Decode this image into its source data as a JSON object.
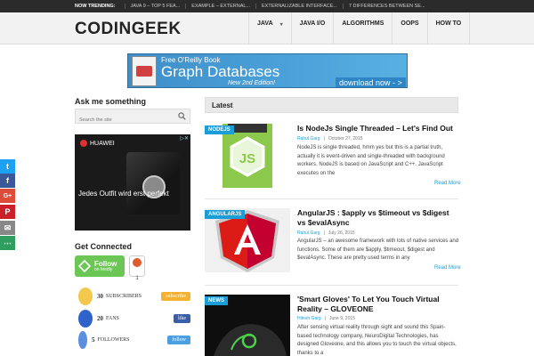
{
  "trending": {
    "label": "NOW TRENDING:",
    "items": [
      "JAVA 9 – TOP 5 FEA...",
      "EXAMPLE – EXTERNAL...",
      "EXTERNALIZABLE INTERFACE...",
      "7 DIFFERENCES BETWEEN SE..."
    ]
  },
  "header": {
    "logo": "CODINGEEK",
    "nav": [
      {
        "label": "JAVA",
        "has_dropdown": true
      },
      {
        "label": "JAVA I/O",
        "has_dropdown": false
      },
      {
        "label": "ALGORITHMS",
        "has_dropdown": false
      },
      {
        "label": "OOPS",
        "has_dropdown": false
      },
      {
        "label": "HOW TO",
        "has_dropdown": false
      }
    ]
  },
  "banner_ad": {
    "top_text": "Free O'Reilly Book",
    "main_text": "Graph Databases",
    "edition": "New 2nd Edition!",
    "cta": "download now - >"
  },
  "sidebar": {
    "ask_heading": "Ask me something",
    "search_placeholder": "Search the site",
    "ad": {
      "brand": "HUAWEI",
      "slogan": "Jedes Outfit wird erst perfekt"
    },
    "connected_heading": "Get Connected",
    "feedly": {
      "line1": "Follow",
      "line2": "on feedly",
      "count": "1"
    },
    "social": [
      {
        "count": "30",
        "label": "SUBSCRIBERS",
        "button": "subscribe",
        "color": "#f5b130",
        "blob": "#f2c94c"
      },
      {
        "count": "20",
        "label": "FANS",
        "button": "like",
        "color": "#3b5ea8",
        "blob": "#2e63c9"
      },
      {
        "count": "5",
        "label": "FOLLOWERS",
        "button": "follow",
        "color": "#4aa0e0",
        "blob": "#5b8fe0"
      }
    ]
  },
  "share_bar": [
    {
      "icon": "twitter-icon",
      "glyph": "t",
      "color": "#1da1f2"
    },
    {
      "icon": "facebook-icon",
      "glyph": "f",
      "color": "#3b5998"
    },
    {
      "icon": "google-plus-icon",
      "glyph": "G+",
      "color": "#dd4b39"
    },
    {
      "icon": "pinterest-icon",
      "glyph": "P",
      "color": "#cb2027"
    },
    {
      "icon": "email-icon",
      "glyph": "✉",
      "color": "#888888"
    },
    {
      "icon": "more-share-icon",
      "glyph": "⋯",
      "color": "#2f9e5e"
    }
  ],
  "main": {
    "section_title": "Latest",
    "read_more": "Read More",
    "posts": [
      {
        "category": "NODEJS",
        "title": "Is NodeJs Single Threaded – Let's Find Out",
        "author": "Rahul Garg",
        "date": "October 27, 2015",
        "excerpt": "NodeJS is single threaded, hmm yes but this is a partial truth, actually it is event-driven and single-threaded with background workers. NodeJS is based on  JavaScript and C++.  JavaScript executes on the"
      },
      {
        "category": "ANGULARJS",
        "title": "AngularJS : $apply vs $timeout vs $digest vs $evalAsync",
        "author": "Rahul Garg",
        "date": "July 26, 2015",
        "excerpt": "AngularJS – an awesome framework with lots of native services and functions. Some of them are $apply, $timeout, $digest and $evalAsync. These are pretty used terms in any"
      },
      {
        "category": "NEWS",
        "title": "'Smart Gloves' To Let You Touch Virtual Reality – GLOVEONE",
        "author": "Hitesh Garg",
        "date": "June 9, 2015",
        "excerpt": "After sensing virtual reality through sight and sound this Spain-based technology company, NeuroDigital Technologies, has designed Gloveone, and this allows you to touch the virtual objects, thanks to a"
      }
    ]
  }
}
